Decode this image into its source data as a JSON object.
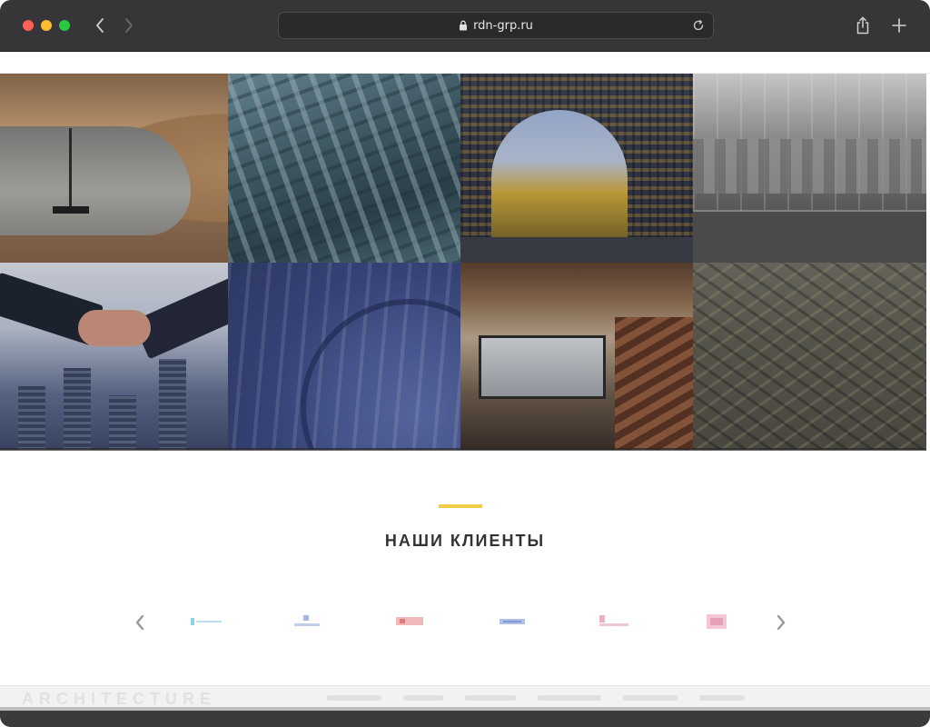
{
  "browser": {
    "url": "rdn-grp.ru",
    "traffic_colors": [
      "#fe5f57",
      "#febc2e",
      "#28c840"
    ],
    "icons": [
      "chevron-left-icon",
      "chevron-right-icon",
      "lock-icon",
      "reload-icon",
      "share-icon",
      "plus-icon"
    ]
  },
  "gallery": {
    "tiles": [
      {
        "name": "curved-interior"
      },
      {
        "name": "industrial-steel"
      },
      {
        "name": "building-arch"
      },
      {
        "name": "shelving-interior"
      },
      {
        "name": "handshake"
      },
      {
        "name": "blue-abstract"
      },
      {
        "name": "loft-interior"
      },
      {
        "name": "warehouse"
      }
    ]
  },
  "clients": {
    "title": "НАШИ КЛИЕНТЫ",
    "accent_color": "#f2cb4a",
    "logos": [
      {
        "color": "#7fd0e8"
      },
      {
        "color": "#8aa6d8"
      },
      {
        "color": "#e89a9a"
      },
      {
        "color": "#8fa3d6"
      },
      {
        "color": "#e6a0b4"
      },
      {
        "color": "#e8a8c0"
      }
    ]
  },
  "footer": {
    "brand": "ARCHITECTURE"
  }
}
